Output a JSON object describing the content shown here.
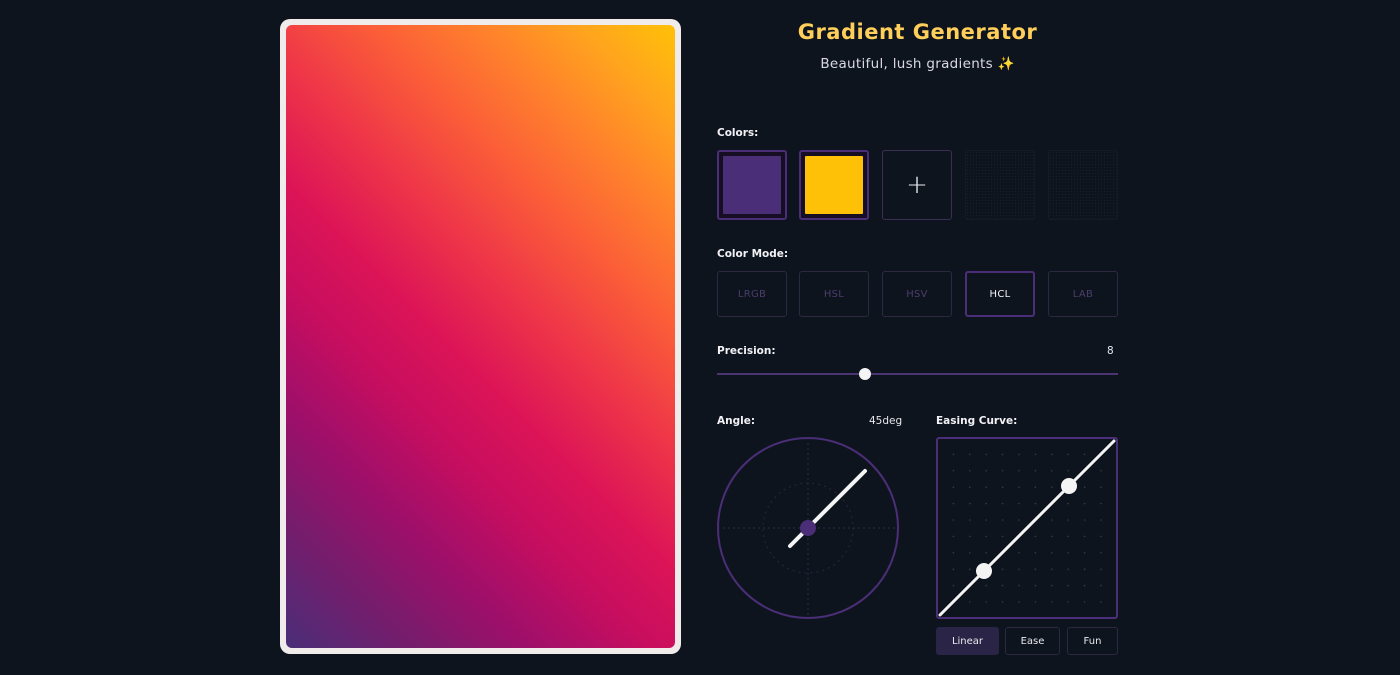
{
  "app": {
    "title": "Gradient Generator",
    "subtitle": "Beautiful, lush gradients ✨"
  },
  "preview": {
    "angle_deg": 45,
    "gradient_from": "#4a2e78",
    "gradient_to": "#ffc107"
  },
  "colors": {
    "label": "Colors:",
    "swatches": [
      "#4a2e78",
      "#ffc107"
    ],
    "add_label": "+"
  },
  "color_mode": {
    "label": "Color Mode:",
    "options": [
      "LRGB",
      "HSL",
      "HSV",
      "HCL",
      "LAB"
    ],
    "selected": "HCL"
  },
  "precision": {
    "label": "Precision:",
    "value": "8",
    "level_fraction": 0.37
  },
  "angle": {
    "label": "Angle:",
    "value": "45deg"
  },
  "easing": {
    "label": "Easing Curve:",
    "options": [
      "Linear",
      "Ease",
      "Fun"
    ],
    "selected": "Linear"
  },
  "theme": {
    "title_color": "#ffcf5a",
    "accent": "#4a2e78",
    "background": "#0e141d"
  }
}
